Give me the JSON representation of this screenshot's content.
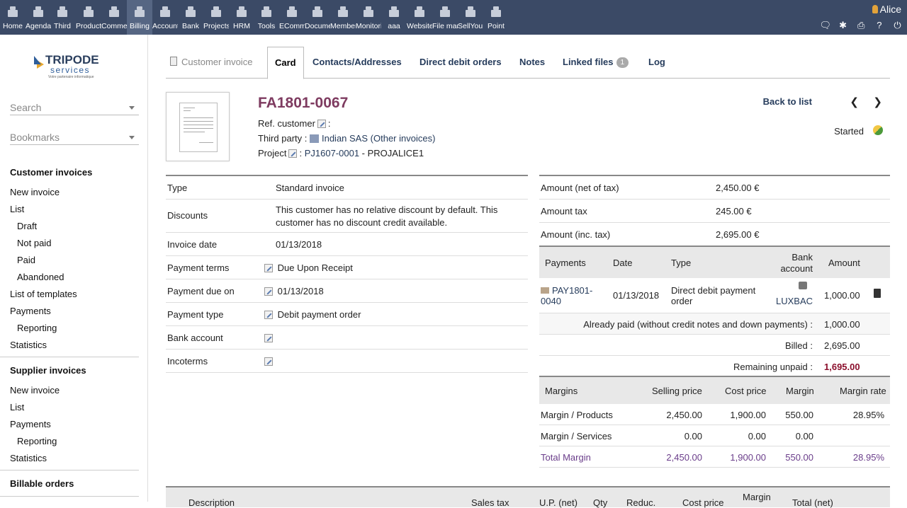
{
  "topmenu": [
    {
      "label": "Home",
      "icon": "home-icon"
    },
    {
      "label": "Agenda",
      "icon": "agenda-icon"
    },
    {
      "label": "Third",
      "icon": "thirdparty-icon"
    },
    {
      "label": "Products",
      "icon": "products-icon"
    },
    {
      "label": "Commerce",
      "icon": "commerce-icon"
    },
    {
      "label": "Billing",
      "icon": "billing-icon",
      "active": true
    },
    {
      "label": "Accounting",
      "icon": "accounting-icon"
    },
    {
      "label": "Bank",
      "icon": "bank-icon"
    },
    {
      "label": "Projects",
      "icon": "projects-icon"
    },
    {
      "label": "HRM",
      "icon": "hrm-icon"
    },
    {
      "label": "Tools",
      "icon": "tools-icon"
    },
    {
      "label": "ECommerce",
      "icon": "ecommerce-icon"
    },
    {
      "label": "Documents",
      "icon": "documents-icon"
    },
    {
      "label": "Members",
      "icon": "members-icon"
    },
    {
      "label": "Monitoring",
      "icon": "monitoring-icon"
    },
    {
      "label": "aaa",
      "icon": "aaa-icon"
    },
    {
      "label": "Websites",
      "icon": "websites-icon"
    },
    {
      "label": "File manager",
      "icon": "filemanager-icon"
    },
    {
      "label": "SellYourSaas",
      "icon": "sellyoursaas-icon"
    },
    {
      "label": "Point",
      "icon": "pos-icon"
    }
  ],
  "user": {
    "name": "Alice"
  },
  "sidebar": {
    "search_label": "Search",
    "bookmarks_label": "Bookmarks",
    "customer_invoices": "Customer invoices",
    "new_invoice": "New invoice",
    "list": "List",
    "draft": "Draft",
    "not_paid": "Not paid",
    "paid": "Paid",
    "abandoned": "Abandoned",
    "list_templates": "List of templates",
    "payments": "Payments",
    "reporting": "Reporting",
    "statistics": "Statistics",
    "supplier_invoices": "Supplier invoices",
    "s_new_invoice": "New invoice",
    "s_list": "List",
    "s_payments": "Payments",
    "s_reporting": "Reporting",
    "s_statistics": "Statistics",
    "billable_orders": "Billable orders"
  },
  "logo": {
    "line1": "TRIPODE",
    "line2": "services",
    "tagline": "Votre partenaire informatique"
  },
  "tabs": {
    "customer_invoice": "Customer invoice",
    "card": "Card",
    "contacts": "Contacts/Addresses",
    "direct_debit": "Direct debit orders",
    "notes": "Notes",
    "linked_files": "Linked files",
    "linked_count": "1",
    "log": "Log"
  },
  "header": {
    "ref": "FA1801-0067",
    "ref_customer_label": "Ref. customer",
    "third_party_label": "Third party :",
    "third_party": "Indian SAS",
    "other_invoices": "Other invoices",
    "project_label": "Project",
    "project_ref": "PJ1607-0001",
    "project_name": "- PROJALICE1",
    "back_to_list": "Back to list",
    "status": "Started"
  },
  "info": {
    "type_label": "Type",
    "type_value": "Standard invoice",
    "discounts_label": "Discounts",
    "discounts_value": "This customer has no relative discount by default. This customer has no discount credit available.",
    "invoice_date_label": "Invoice date",
    "invoice_date_value": "01/13/2018",
    "payment_terms_label": "Payment terms",
    "payment_terms_value": "Due Upon Receipt",
    "payment_due_label": "Payment due on",
    "payment_due_value": "01/13/2018",
    "payment_type_label": "Payment type",
    "payment_type_value": "Debit payment order",
    "bank_account_label": "Bank account",
    "incoterms_label": "Incoterms"
  },
  "amounts": {
    "net_label": "Amount (net of tax)",
    "net_value": "2,450.00 €",
    "tax_label": "Amount tax",
    "tax_value": "245.00 €",
    "inc_label": "Amount (inc. tax)",
    "inc_value": "2,695.00 €"
  },
  "payments": {
    "h_payments": "Payments",
    "h_date": "Date",
    "h_type": "Type",
    "h_bank1": "Bank",
    "h_bank2": "account",
    "h_amount": "Amount",
    "ref1": "PAY1801-",
    "ref2": "0040",
    "date": "01/13/2018",
    "type1": "Direct debit payment",
    "type2": "order",
    "bank": "LUXBAC",
    "amount": "1,000.00",
    "already_paid_label": "Already paid (without credit notes and down payments) :",
    "already_paid": "1,000.00",
    "billed_label": "Billed :",
    "billed": "2,695.00",
    "remaining_label": "Remaining unpaid :",
    "remaining": "1,695.00",
    "remaining_color": "#8b0f2c"
  },
  "margins": {
    "h_margins": "Margins",
    "h_selling": "Selling price",
    "h_cost": "Cost price",
    "h_margin": "Margin",
    "h_rate": "Margin rate",
    "rows": [
      {
        "label": "Margin / Products",
        "selling": "2,450.00",
        "cost": "1,900.00",
        "margin": "550.00",
        "rate": "28.95%"
      },
      {
        "label": "Margin / Services",
        "selling": "0.00",
        "cost": "0.00",
        "margin": "0.00",
        "rate": ""
      },
      {
        "label": "Total Margin",
        "selling": "2,450.00",
        "cost": "1,900.00",
        "margin": "550.00",
        "rate": "28.95%"
      }
    ]
  },
  "lines": {
    "description": "Description",
    "sales_tax": "Sales tax",
    "up_net": "U.P. (net)",
    "qty": "Qty",
    "reduc": "Reduc.",
    "cost_price": "Cost price",
    "margin": "Margin",
    "total_net": "Total (net)"
  }
}
